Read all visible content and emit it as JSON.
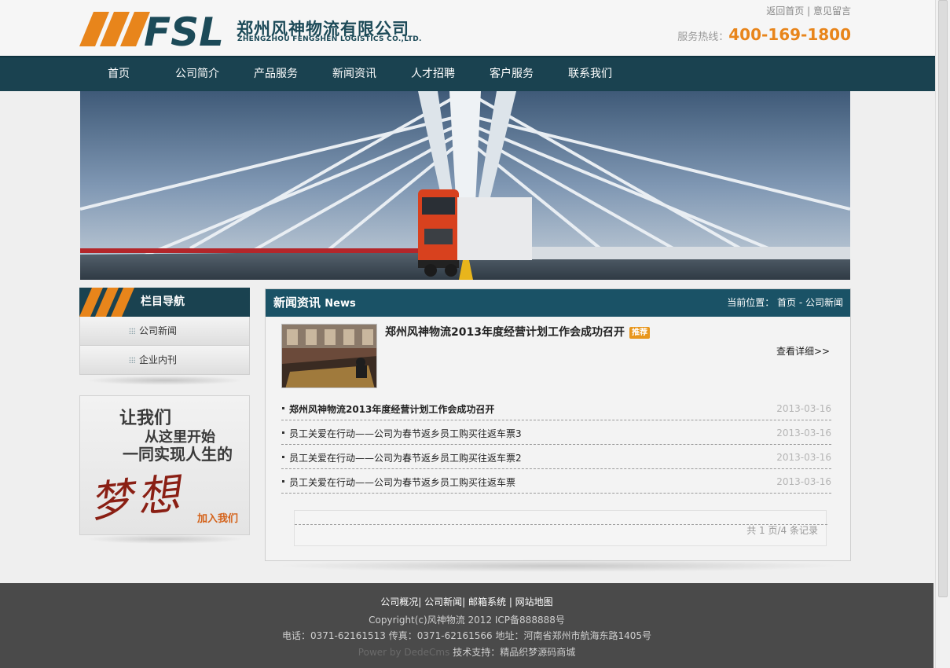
{
  "header": {
    "logo_cn": "郑州风神物流有限公司",
    "logo_en": "ZHENGZHOU FENGSHEN LOGISTICS CO.,LTD.",
    "links": [
      "返回首页",
      "意见留言"
    ],
    "hotline_label": "服务热线：",
    "hotline_number": "400-169-1800"
  },
  "nav": {
    "items": [
      "首页",
      "公司简介",
      "产品服务",
      "新闻资讯",
      "人才招聘",
      "客户服务",
      "联系我们"
    ]
  },
  "sidebar": {
    "title": "栏目导航",
    "items": [
      "公司新闻",
      "企业内刊"
    ],
    "join": {
      "line1": "让我们",
      "line2": "从这里开始",
      "line3": "一同实现人生的",
      "dream": "梦想",
      "cta": "加入我们"
    }
  },
  "main": {
    "title": "新闻资讯",
    "title_en": "News",
    "breadcrumb": "当前位置： 首页 - 公司新闻",
    "featured": {
      "title": "郑州风神物流2013年度经营计划工作会成功召开",
      "tag": "推荐",
      "detail_link": "查看详细>>"
    },
    "news": [
      {
        "title": "郑州风神物流2013年度经营计划工作会成功召开",
        "date": "2013-03-16",
        "bold": true
      },
      {
        "title": "员工关爱在行动——公司为春节返乡员工购买往返车票3",
        "date": "2013-03-16",
        "bold": false
      },
      {
        "title": "员工关爱在行动——公司为春节返乡员工购买往返车票2",
        "date": "2013-03-16",
        "bold": false
      },
      {
        "title": "员工关爱在行动——公司为春节返乡员工购买往返车票",
        "date": "2013-03-16",
        "bold": false
      }
    ],
    "pager": "共 1 页/4 条记录"
  },
  "footer": {
    "links": "公司概况| 公司新闻| 邮箱系统  | 网站地图",
    "copyright": "Copyright(c)风神物流  2012 ICP备888888号",
    "contact": "电话：0371-62161513 传真：0371-62161566 地址：河南省郑州市航海东路1405号",
    "power_prefix": "Power by DedeCms",
    "support": " 技术支持：精品织梦源码商城"
  },
  "colors": {
    "nav_bg": "#1a4250",
    "accent_orange": "#e8851b",
    "main_head_bg": "#1a5266",
    "footer_bg": "#4a4a4a"
  }
}
